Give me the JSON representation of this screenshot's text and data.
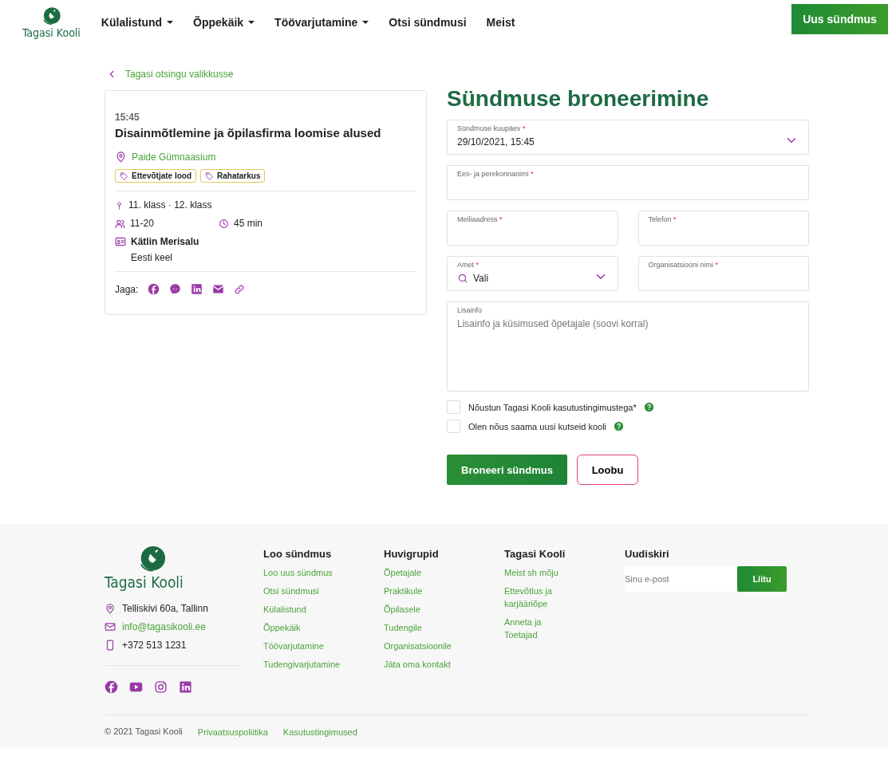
{
  "header": {
    "logo": "Tagasi Kooli",
    "nav": [
      {
        "label": "Külalistund",
        "dropdown": true
      },
      {
        "label": "Õppekäik",
        "dropdown": true
      },
      {
        "label": "Töövarjutamine",
        "dropdown": true
      },
      {
        "label": "Otsi sündmusi",
        "dropdown": false
      },
      {
        "label": "Meist",
        "dropdown": false
      }
    ],
    "cta": "Uus sündmus"
  },
  "back_link": "Tagasi otsingu valikkusse",
  "event": {
    "time": "15:45",
    "title": "Disainmõtlemine ja õpilasfirma loomise alused",
    "location": "Paide Gümnaasium",
    "tags": [
      "Ettevõtjate lood",
      "Rahatarkus"
    ],
    "grades": "11. klass · 12. klass",
    "participants": "11-20",
    "duration": "45 min",
    "teacher": "Kätlin Merisalu",
    "language": "Eesti keel",
    "share_label": "Jaga:"
  },
  "form": {
    "title": "Sündmuse broneerimine",
    "fields": [
      {
        "kind": "select",
        "label": "Sündmuse kuupäev",
        "required_mark": "*",
        "value": "29/10/2021, 15:45",
        "wide": true
      },
      {
        "kind": "text",
        "label": "Ees- ja perekonnanimi",
        "required_mark": "*",
        "wide": true
      },
      {
        "kind": "text",
        "label": "Meiliaadress",
        "required_mark": "*",
        "wide": false
      },
      {
        "kind": "text",
        "label": "Telefon",
        "required_mark": "*",
        "wide": false
      },
      {
        "kind": "search-select",
        "label": "Amet",
        "required_mark": "*",
        "value": "Vali",
        "wide": false
      },
      {
        "kind": "text",
        "label": "Organisatsiooni nimi",
        "required_mark": "*",
        "wide": false
      },
      {
        "kind": "textarea",
        "label": "Lisainfo",
        "placeholder": "Lisainfo ja küsimused õpetajale (soovi korral)",
        "wide": true
      }
    ],
    "checkboxes": [
      {
        "label": "Nõustun Tagasi Kooli kasutustingimustega*",
        "checked": false
      },
      {
        "label": "Olen nõus saama uusi kutseid kooli",
        "checked": false
      }
    ],
    "submit": "Broneeri sündmus",
    "cancel": "Loobu"
  },
  "footer": {
    "logo": "Tagasi Kooli",
    "address": "Telliskivi 60a, Tallinn",
    "email": "info@tagasikooli.ee",
    "phone": "+372 513 1231",
    "columns": [
      {
        "heading": "Loo sündmus",
        "links": [
          "Loo uus sündmus",
          "Otsi sündmusi",
          "Külalistund",
          "Õppekäik",
          "Töövarjutamine",
          "Tudengivarjutamine"
        ]
      },
      {
        "heading": "Huvigrupid",
        "links": [
          "Õpetajale",
          "Praktikule",
          "Õpilasele",
          "Tudengile",
          "Organisatsioonile",
          "Jäta oma kontakt"
        ]
      },
      {
        "heading": "Tagasi Kooli",
        "links": [
          "Meist sh mõju",
          "Ettevõtlus ja karjääriõpe",
          "Anneta ja Toetajad"
        ]
      }
    ],
    "newsletter": {
      "heading": "Uudiskiri",
      "placeholder": "Sinu e-post",
      "button": "Liitu"
    },
    "copyright": "© 2021 Tagasi Kooli",
    "legal_links": [
      "Privaatsuspoliitika",
      "Kasutustingimused"
    ]
  }
}
